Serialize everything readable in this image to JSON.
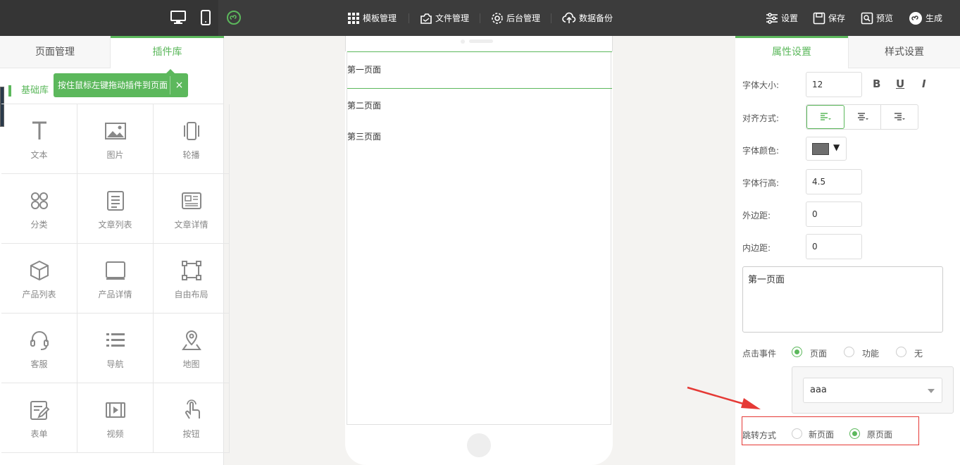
{
  "topbar": {
    "nav": [
      "模板管理",
      "文件管理",
      "后台管理",
      "数据备份"
    ],
    "actions": [
      "设置",
      "保存",
      "预览",
      "生成"
    ]
  },
  "left": {
    "tabs": [
      "页面管理",
      "插件库"
    ],
    "tooltip": "按住鼠标左键拖动插件到页面",
    "tooltip_close": "×",
    "library_title": "基础库",
    "plugins": [
      {
        "label": "文本",
        "icon": "text-icon"
      },
      {
        "label": "图片",
        "icon": "image-icon"
      },
      {
        "label": "轮播",
        "icon": "carousel-icon"
      },
      {
        "label": "分类",
        "icon": "category-icon"
      },
      {
        "label": "文章列表",
        "icon": "article-list-icon"
      },
      {
        "label": "文章详情",
        "icon": "article-detail-icon"
      },
      {
        "label": "产品列表",
        "icon": "product-list-icon"
      },
      {
        "label": "产品详情",
        "icon": "product-detail-icon"
      },
      {
        "label": "自由布局",
        "icon": "free-layout-icon"
      },
      {
        "label": "客服",
        "icon": "headset-icon"
      },
      {
        "label": "导航",
        "icon": "nav-list-icon"
      },
      {
        "label": "地图",
        "icon": "map-pin-icon"
      },
      {
        "label": "表单",
        "icon": "form-icon"
      },
      {
        "label": "视频",
        "icon": "video-icon"
      },
      {
        "label": "按钮",
        "icon": "tap-icon"
      }
    ]
  },
  "phone": {
    "items": [
      "第一页面",
      "第二页面",
      "第三页面"
    ]
  },
  "right": {
    "tabs": [
      "属性设置",
      "样式设置"
    ],
    "font_size_label": "字体大小:",
    "font_size": "12",
    "align_label": "对齐方式:",
    "color_label": "字体颜色:",
    "line_height_label": "字体行高:",
    "line_height": "4.5",
    "margin_label": "外边距:",
    "margin": "0",
    "padding_label": "内边距:",
    "padding": "0",
    "text_value": "第一页面",
    "click_label": "点击事件",
    "click_options": [
      "页面",
      "功能",
      "无"
    ],
    "select_value": "aaa",
    "jump_label": "跳转方式",
    "jump_options": [
      "新页面",
      "原页面"
    ],
    "format_buttons": [
      "B",
      "U",
      "I"
    ]
  },
  "colors": {
    "accent": "#5cb85c",
    "topbar": "#3c3c3c",
    "annotation": "#e53935"
  }
}
